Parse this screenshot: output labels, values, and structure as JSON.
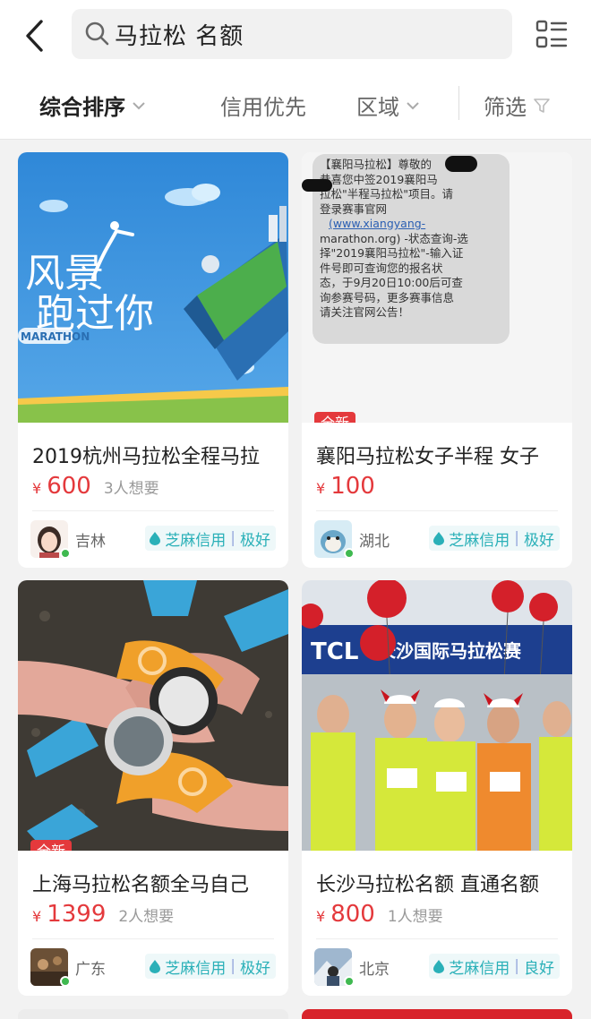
{
  "search": {
    "query": "马拉松 名额"
  },
  "filters": {
    "sort": "综合排序",
    "credit_first": "信用优先",
    "region": "区域",
    "filter": "筛选"
  },
  "colors": {
    "accent": "#e4393c",
    "credit": "#2ab0b8"
  },
  "items": [
    {
      "title": "2019杭州马拉松全程马拉",
      "currency": "¥",
      "price": "600",
      "want": "3人想要",
      "badge": "",
      "location": "吉林",
      "credit": {
        "label": "芝麻信用",
        "level": "极好"
      },
      "image_text": [
        "风景",
        "跑过你",
        "MARATHON"
      ]
    },
    {
      "title": "襄阳马拉松女子半程 女子",
      "currency": "¥",
      "price": "100",
      "want": "",
      "badge": "全新",
      "location": "湖北",
      "credit": {
        "label": "芝麻信用",
        "level": "极好"
      },
      "image_text": [
        "【襄阳马拉松】尊敬的",
        "恭喜您中签2019襄阳马",
        "拉松\"半程马拉松\"项目。请",
        "登录赛事官网",
        "(www.xiangyang-",
        "marathon.org) -状态查询-选",
        "择\"2019襄阳马拉松\"-输入证",
        "件号即可查询您的报名状",
        "态，于9月20日10:00后可查",
        "询参赛号码，更多赛事信息",
        "请关注官网公告！"
      ]
    },
    {
      "title": "上海马拉松名额全马自己",
      "currency": "¥",
      "price": "1399",
      "want": "2人想要",
      "badge": "全新",
      "location": "广东",
      "credit": {
        "label": "芝麻信用",
        "level": "极好"
      },
      "image_text": []
    },
    {
      "title": "长沙马拉松名额 直通名额",
      "currency": "¥",
      "price": "800",
      "want": "1人想要",
      "badge": "",
      "location": "北京",
      "credit": {
        "label": "芝麻信用",
        "level": "良好"
      },
      "image_text": [
        "TCL",
        "长沙国际马拉松赛"
      ]
    }
  ]
}
